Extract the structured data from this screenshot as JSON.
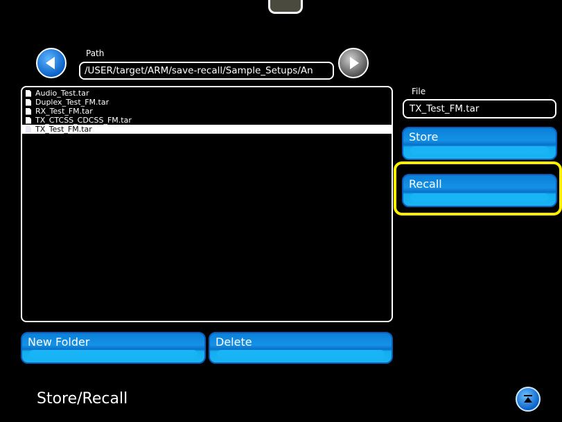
{
  "path": {
    "label": "Path",
    "value": "/USER/target/ARM/save-recall/Sample_Setups/An"
  },
  "files": [
    {
      "name": "Audio_Test.tar",
      "selected": false
    },
    {
      "name": "Duplex_Test_FM.tar",
      "selected": false
    },
    {
      "name": "RX_Test_FM.tar",
      "selected": false
    },
    {
      "name": "TX_CTCSS_CDCSS_FM.tar",
      "selected": false
    },
    {
      "name": "TX_Test_FM.tar",
      "selected": true
    }
  ],
  "file": {
    "label": "File",
    "value": "TX_Test_FM.tar"
  },
  "buttons": {
    "store": "Store",
    "recall": "Recall",
    "new_folder": "New Folder",
    "delete": "Delete"
  },
  "page_title": "Store/Recall",
  "icons": {
    "back": "left-arrow-icon",
    "forward": "right-arrow-icon",
    "scroll": "scroll-top-icon",
    "file": "document-icon"
  },
  "colors": {
    "accent": "#0a7fd8",
    "highlight": "#ffee00",
    "background": "#000000"
  }
}
